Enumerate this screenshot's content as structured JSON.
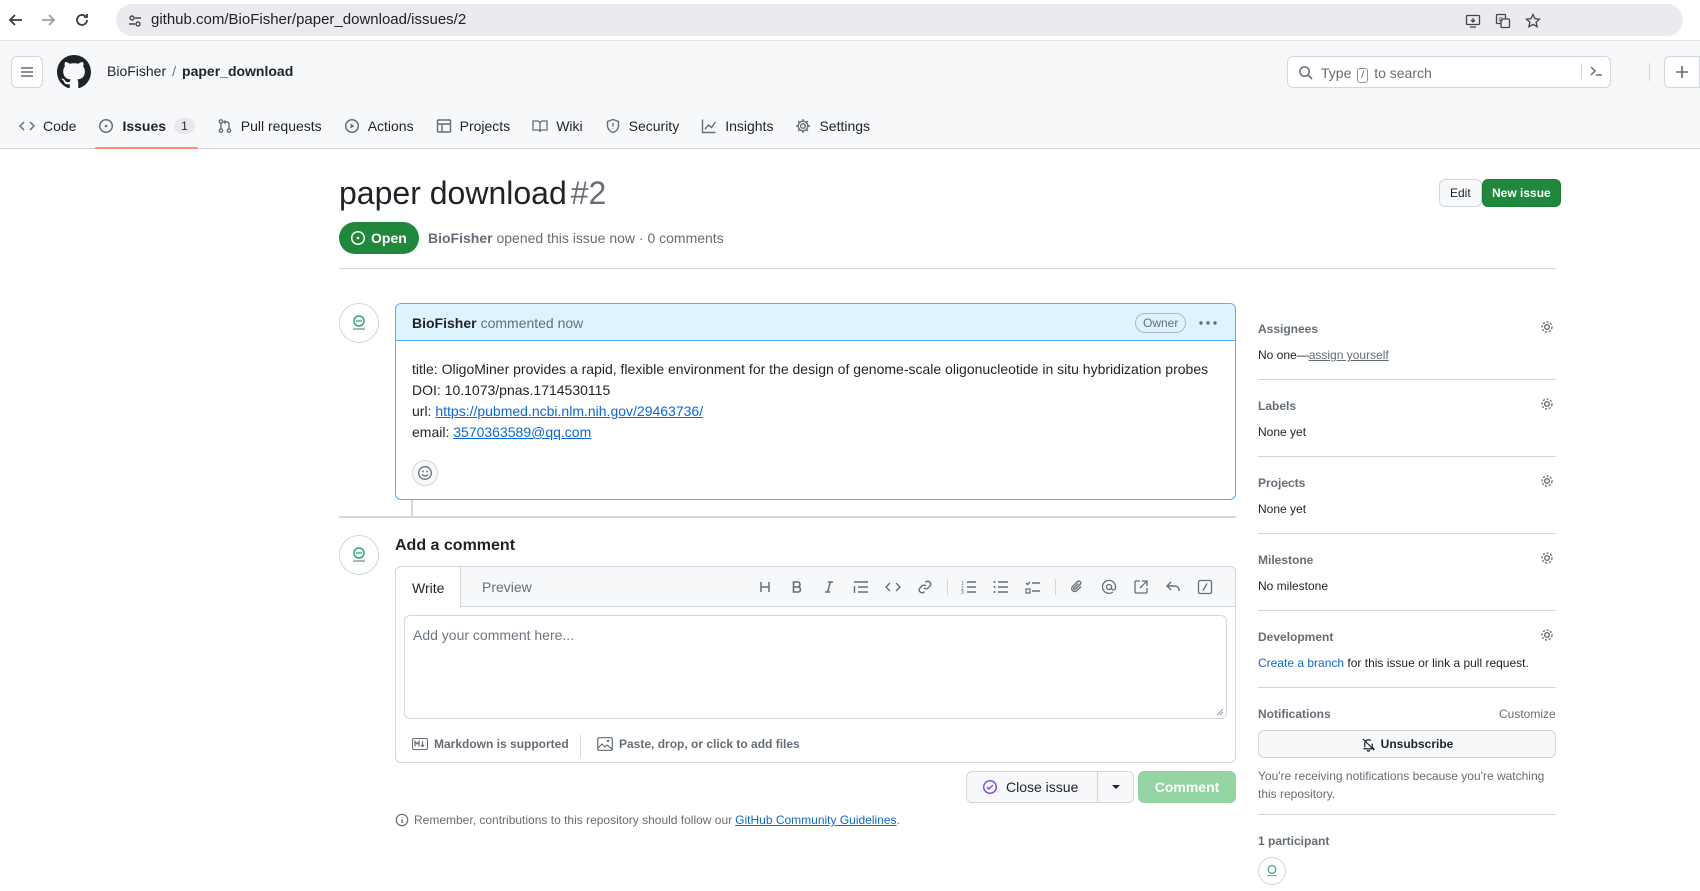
{
  "browser": {
    "url": "github.com/BioFisher/paper_download/issues/2"
  },
  "header": {
    "owner": "BioFisher",
    "separator": "/",
    "repo": "paper_download",
    "search_prefix": "Type",
    "search_key": "/",
    "search_suffix": "to search"
  },
  "tabs": [
    {
      "label": "Code",
      "icon": "code-icon"
    },
    {
      "label": "Issues",
      "icon": "issue-opened-icon",
      "counter": "1"
    },
    {
      "label": "Pull requests",
      "icon": "git-pull-request-icon"
    },
    {
      "label": "Actions",
      "icon": "play-icon"
    },
    {
      "label": "Projects",
      "icon": "table-icon"
    },
    {
      "label": "Wiki",
      "icon": "book-icon"
    },
    {
      "label": "Security",
      "icon": "shield-icon"
    },
    {
      "label": "Insights",
      "icon": "graph-icon"
    },
    {
      "label": "Settings",
      "icon": "gear-icon"
    }
  ],
  "issue": {
    "title": "paper download",
    "number": "#2",
    "state": "Open",
    "author": "BioFisher",
    "meta_rest": "opened this issue now · 0 comments",
    "edit_label": "Edit",
    "new_issue_label": "New issue"
  },
  "comment": {
    "author": "BioFisher",
    "time": "commented now",
    "badge": "Owner",
    "line1": "title: OligoMiner provides a rapid, flexible environment for the design of genome-scale oligonucleotide in situ hybridization probes",
    "line2": "DOI: 10.1073/pnas.1714530115",
    "url_label": "url:",
    "url": "https://pubmed.ncbi.nlm.nih.gov/29463736/",
    "email_label": "email:",
    "email": "3570363589@qq.com"
  },
  "composer": {
    "heading": "Add a comment",
    "tab_write": "Write",
    "tab_preview": "Preview",
    "placeholder": "Add your comment here...",
    "markdown_note": "Markdown is supported",
    "attach_note": "Paste, drop, or click to add files",
    "close_label": "Close issue",
    "comment_label": "Comment",
    "reminder_prefix": "Remember, contributions to this repository should follow our",
    "reminder_link": "GitHub Community Guidelines",
    "reminder_suffix": "."
  },
  "sidebar": {
    "assignees_title": "Assignees",
    "assignees_value": "No one—",
    "assignees_link": "assign yourself",
    "labels_title": "Labels",
    "labels_value": "None yet",
    "projects_title": "Projects",
    "projects_value": "None yet",
    "milestone_title": "Milestone",
    "milestone_value": "No milestone",
    "development_title": "Development",
    "development_link": "Create a branch",
    "development_rest": "for this issue or link a pull request.",
    "notifications_title": "Notifications",
    "customize": "Customize",
    "unsubscribe": "Unsubscribe",
    "notif_text": "You're receiving notifications because you're watching this repository.",
    "participants_title": "1 participant"
  },
  "colors": {
    "accent_green": "#1f883d",
    "link_blue": "#0969da",
    "tab_underline": "#fd8c73",
    "comment_header_bg": "#ddf4ff"
  }
}
